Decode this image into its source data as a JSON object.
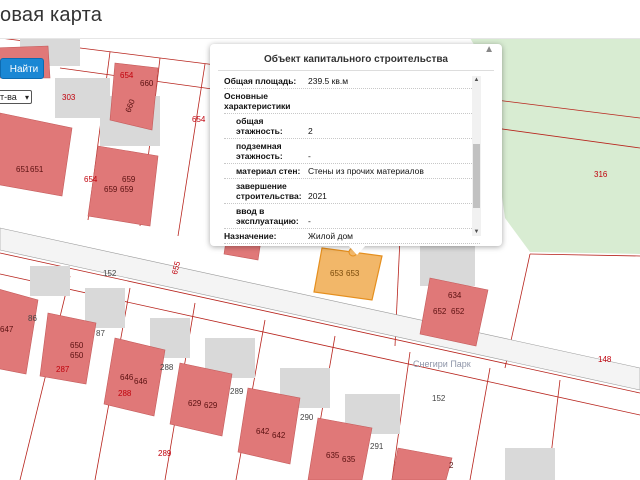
{
  "header": {
    "title": "овая карта"
  },
  "search": {
    "find_button": "Найти",
    "select_value": "т-ва"
  },
  "popup": {
    "title": "Объект капитального строительства",
    "close_icon": "close-icon",
    "rows": [
      {
        "label": "Общая площадь",
        "value": "239.5 кв.м"
      },
      {
        "label": "Основные характеристики",
        "value": ""
      },
      {
        "label": "общая этажность",
        "value": "2"
      },
      {
        "label": "подземная этажность",
        "value": "-"
      },
      {
        "label": "материал стен",
        "value": "Стены из прочих материалов"
      },
      {
        "label": "завершение строительства",
        "value": "2021"
      },
      {
        "label": "ввод в эксплуатацию",
        "value": "-"
      },
      {
        "label": "Назначение",
        "value": "Жилой дом"
      }
    ]
  },
  "map": {
    "place_name": "Снегири Парк",
    "parcel_numbers": [
      "316",
      "148",
      "654",
      "654",
      "654",
      "655",
      "303",
      "152",
      "152",
      "289",
      "288",
      "287",
      "288",
      "289",
      "290",
      "291",
      "86",
      "87"
    ],
    "building_numbers": [
      "660",
      "660",
      "651",
      "651",
      "659",
      "659",
      "659",
      "647",
      "650",
      "650",
      "646",
      "646",
      "629",
      "629",
      "642",
      "642",
      "635",
      "635",
      "634",
      "652",
      "652",
      "653",
      "653",
      "2"
    ],
    "colors": {
      "building": "#e07878",
      "selected": "#f2b769",
      "park": "#d8ecd2",
      "shadow": "#d7d7d7"
    }
  }
}
